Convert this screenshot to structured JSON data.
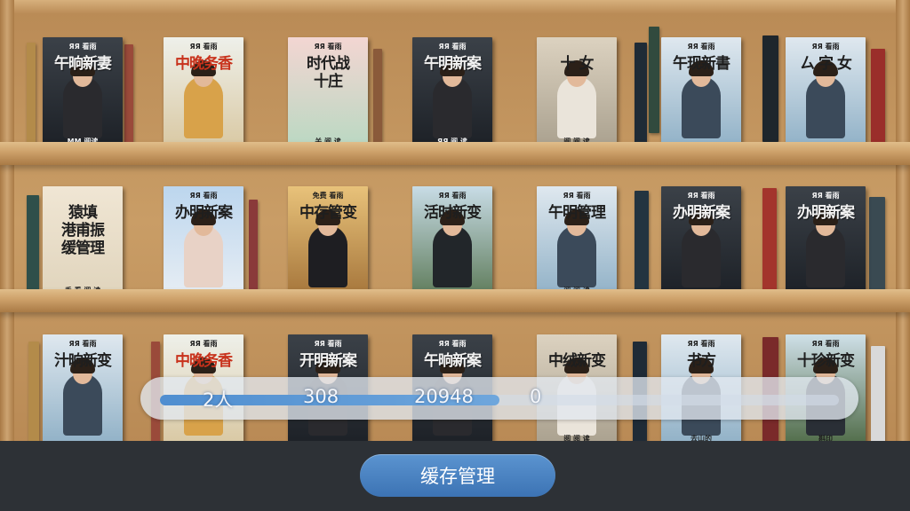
{
  "books": [
    {
      "sub": "ЯЯ 看雨",
      "title": "午晌新妻",
      "footer": "MM 阅读",
      "theme": "dark"
    },
    {
      "sub": "ЯЯ 看雨",
      "title": "中晚务香",
      "footer": "",
      "theme": "red-light"
    },
    {
      "sub": "ЯЯ 看雨",
      "title": "时代战\n十庄",
      "footer": "关 阅 读",
      "theme": "pink"
    },
    {
      "sub": "ЯЯ 看雨",
      "title": "午明新案",
      "footer": "ЯЯ 阅 读",
      "theme": "dark"
    },
    {
      "sub": "",
      "title": "十 女",
      "footer": "阅 阅 读",
      "theme": "beige"
    },
    {
      "sub": "ЯЯ 看雨",
      "title": "午现新書",
      "footer": "",
      "theme": "sky"
    },
    {
      "sub": "ЯЯ 看雨",
      "title": "ㄙ 字 女",
      "footer": "",
      "theme": "sky"
    },
    {
      "sub": "",
      "title": "猿填\n港甫振\n缓管理",
      "footer": "手 看 阅 读",
      "theme": "cream"
    },
    {
      "sub": "ЯЯ 看雨",
      "title": "办明新案",
      "footer": "",
      "theme": "sky-blue"
    },
    {
      "sub": "免费 看雨",
      "title": "中存管变",
      "footer": "",
      "theme": "gold"
    },
    {
      "sub": "ЯЯ 看雨",
      "title": "活时新变",
      "footer": "",
      "theme": "forest"
    },
    {
      "sub": "ЯЯ 看雨",
      "title": "午明管理",
      "footer": "阅 阅 读",
      "theme": "sky"
    },
    {
      "sub": "ЯЯ 看雨",
      "title": "办明新案",
      "footer": "",
      "theme": "dark"
    },
    {
      "sub": "ЯЯ 看雨",
      "title": "办明新案",
      "footer": "",
      "theme": "dark"
    },
    {
      "sub": "ЯЯ 看雨",
      "title": "汁晌新变",
      "footer": "",
      "theme": "sky"
    },
    {
      "sub": "ЯЯ 看雨",
      "title": "中晚务香",
      "footer": "",
      "theme": "red-light"
    },
    {
      "sub": "ЯЯ 看雨",
      "title": "开明新案",
      "footer": "",
      "theme": "dark"
    },
    {
      "sub": "ЯЯ 看雨",
      "title": "午晌新案",
      "footer": "",
      "theme": "dark"
    },
    {
      "sub": "",
      "title": "中绒新变",
      "footer": "阅 阅 读",
      "theme": "beige"
    },
    {
      "sub": "ЯЯ 看雨",
      "title": "书方",
      "footer": "去山的",
      "theme": "sky"
    },
    {
      "sub": "ЯЯ 看雨",
      "title": "十珍新变",
      "footer": "斟印",
      "theme": "green"
    }
  ],
  "stats": {
    "users": "2人",
    "count_a": "308",
    "count_b": "20948",
    "count_c": "0",
    "progress_fraction": 0.5
  },
  "footer": {
    "cache_button_label": "缓存管理"
  }
}
